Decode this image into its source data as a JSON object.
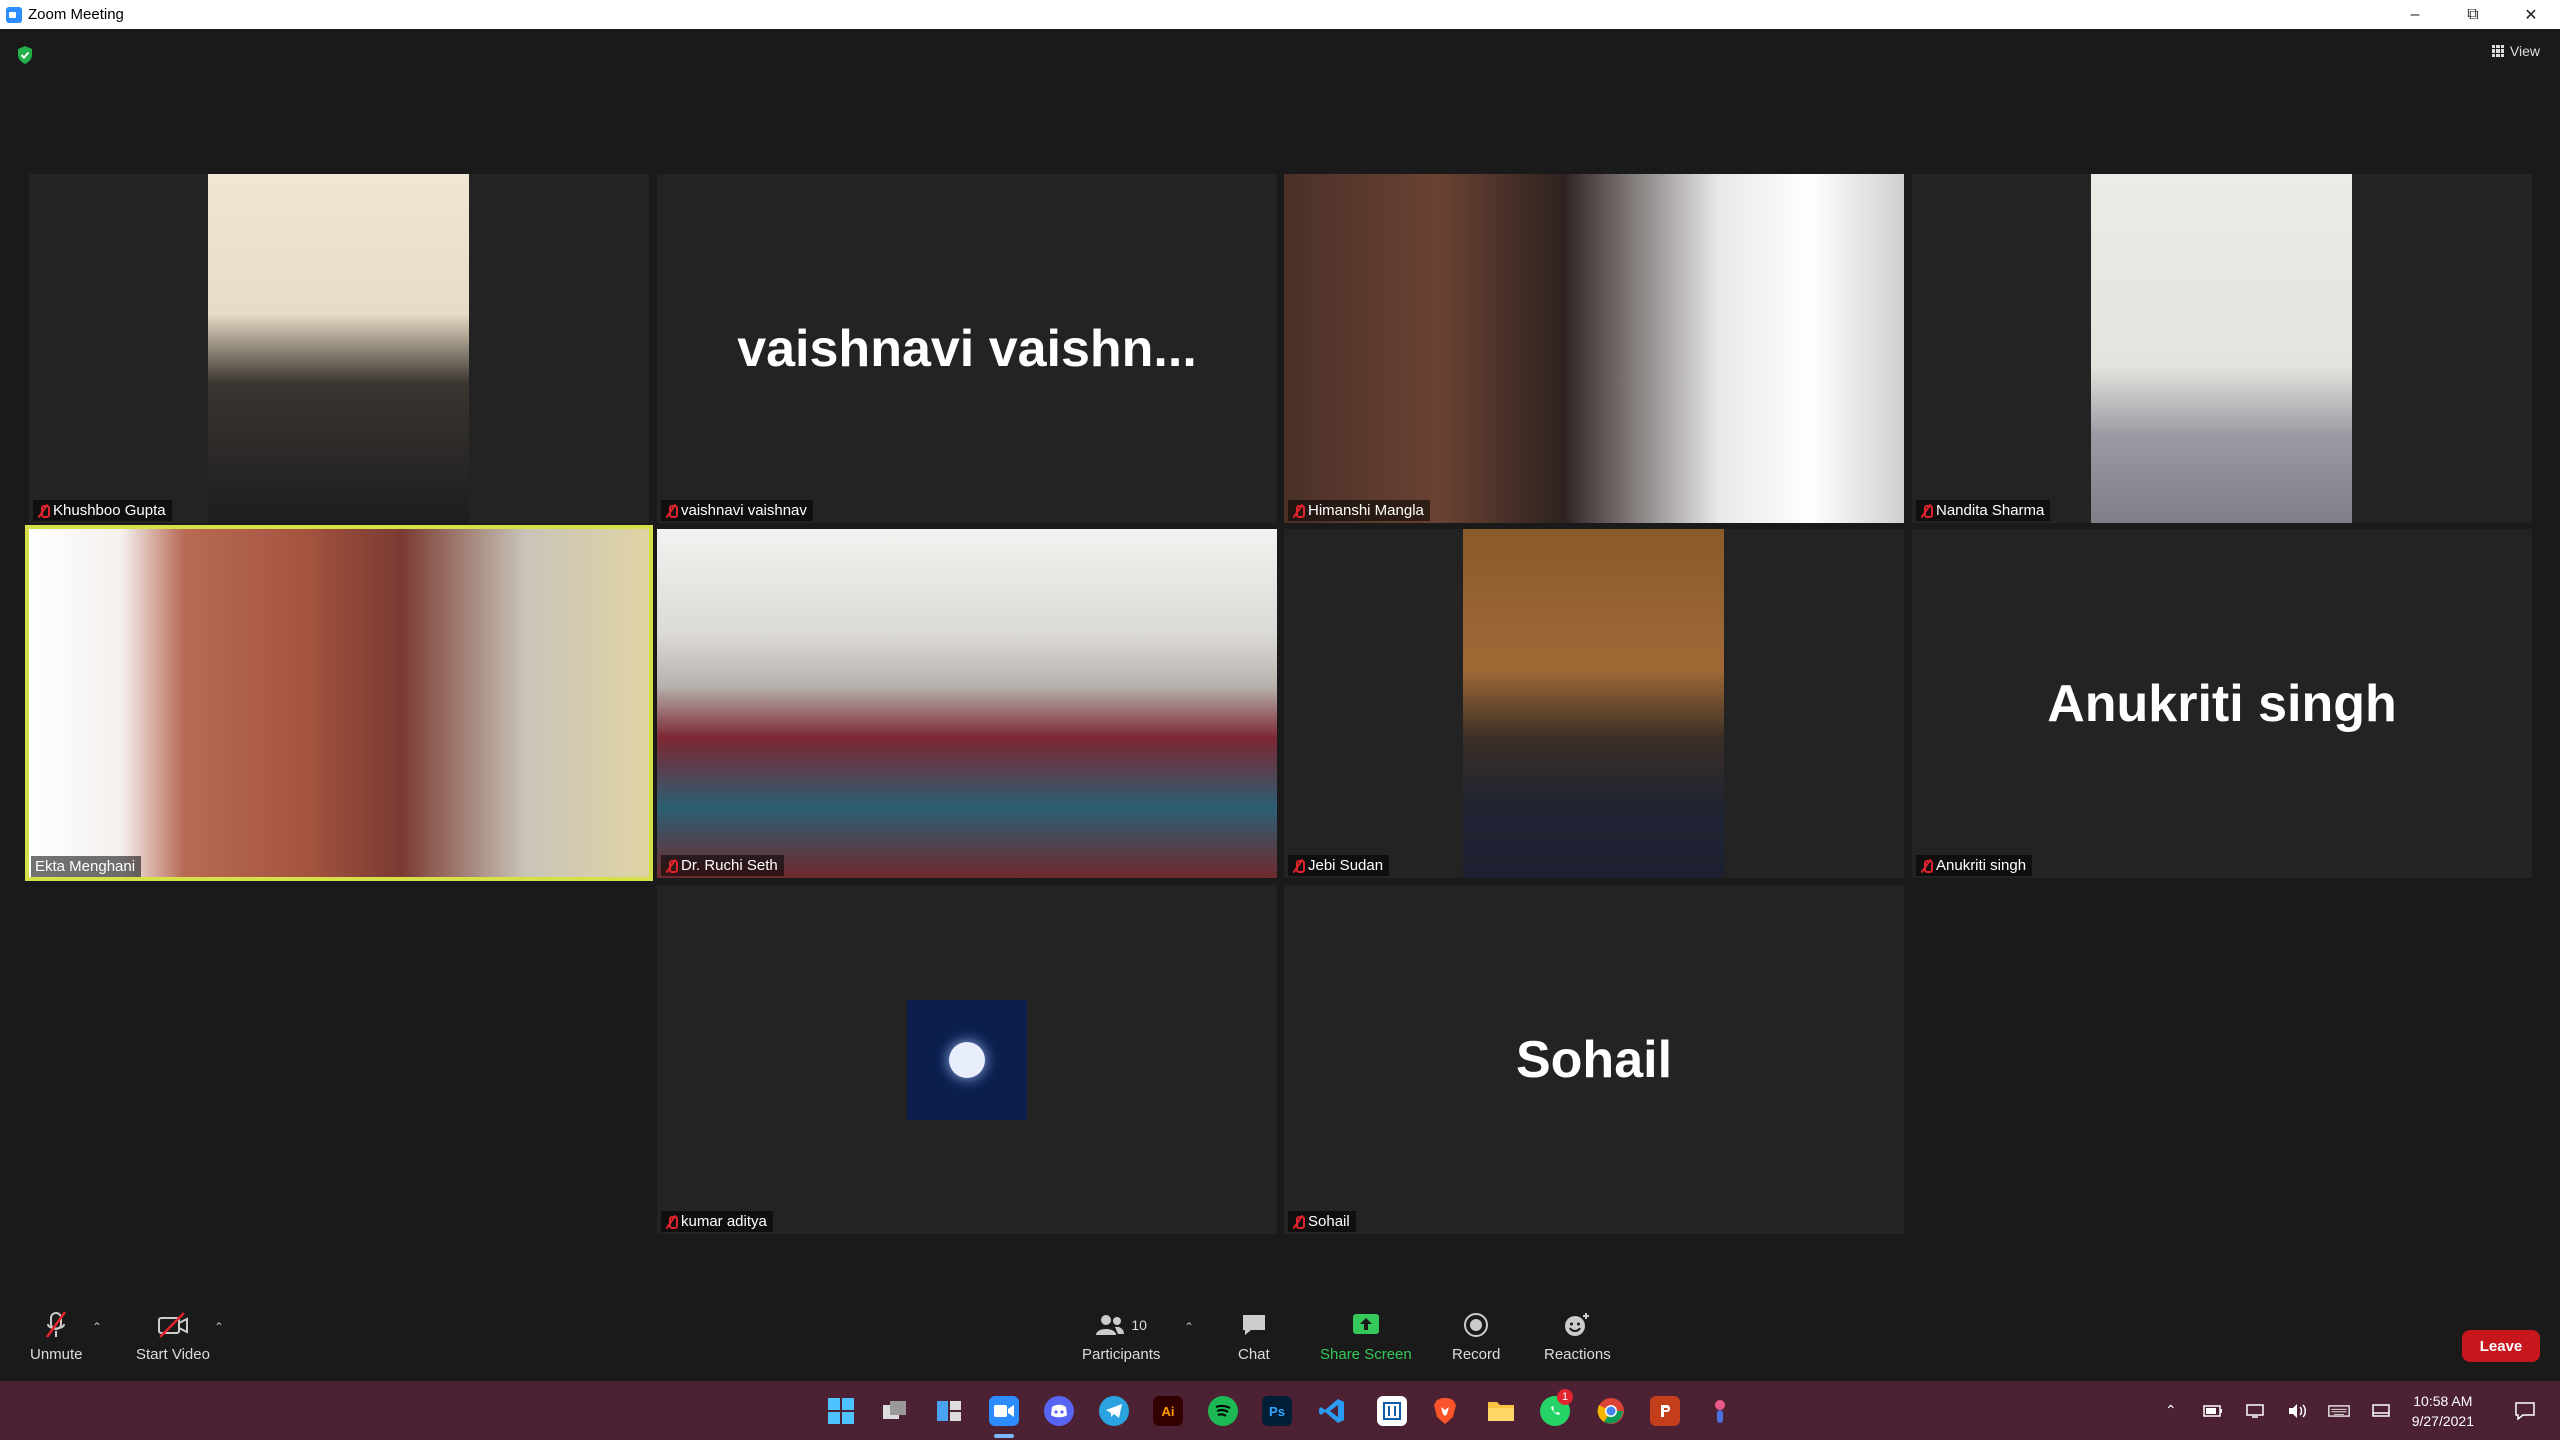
{
  "window": {
    "title": "Zoom Meeting"
  },
  "top": {
    "view_label": "View"
  },
  "participants_grid": [
    {
      "name": "Khushboo Gupta",
      "muted": true
    },
    {
      "name": "vaishnavi vaishnav",
      "muted": true,
      "display_name": "vaishnavi  vaishn..."
    },
    {
      "name": "Himanshi Mangla",
      "muted": true
    },
    {
      "name": "Nandita Sharma",
      "muted": true
    },
    {
      "name": "Ekta Menghani",
      "muted": false
    },
    {
      "name": "Dr. Ruchi Seth",
      "muted": true
    },
    {
      "name": "Jebi Sudan",
      "muted": true
    },
    {
      "name": "Anukriti singh",
      "muted": true,
      "display_name": "Anukriti singh"
    },
    {
      "name": "kumar aditya",
      "muted": true
    },
    {
      "name": "Sohail",
      "muted": true,
      "display_name": "Sohail"
    }
  ],
  "toolbar": {
    "unmute": "Unmute",
    "start_video": "Start Video",
    "participants": "Participants",
    "participants_count": "10",
    "chat": "Chat",
    "share_screen": "Share Screen",
    "record": "Record",
    "reactions": "Reactions",
    "leave": "Leave"
  },
  "taskbar": {
    "time": "10:58 AM",
    "date": "9/27/2021",
    "whatsapp_badge": "1",
    "illustrator_label": "Ai",
    "photoshop_label": "Ps"
  },
  "colors": {
    "active_speaker_border": "#d6e14a",
    "leave_button": "#c8161d",
    "share_screen": "#35c95b",
    "taskbar": "#4b2133"
  }
}
